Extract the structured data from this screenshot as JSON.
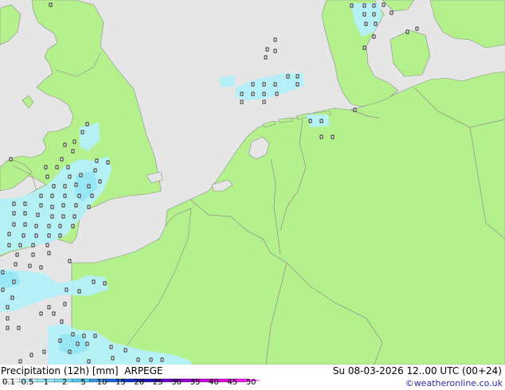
{
  "footer": {
    "title": "Precipitation (12h) [mm]",
    "model": "ARPEGE",
    "valid_time": "Su 08-03-2026 12..00 UTC (00+24)",
    "credit": "©weatheronline.co.uk"
  },
  "legend": {
    "ticks": [
      "0.1",
      "0.5",
      "1",
      "2",
      "5",
      "10",
      "15",
      "20",
      "25",
      "30",
      "35",
      "40",
      "45",
      "50"
    ],
    "colors": [
      "#ffffff",
      "#b4f0fa",
      "#96e6f5",
      "#78dcf0",
      "#4cc8f0",
      "#3296e6",
      "#1e64dc",
      "#1432c8",
      "#2814b4",
      "#6400c8",
      "#9600d2",
      "#c800dc",
      "#e600e6",
      "#f01ef0"
    ]
  },
  "map": {
    "sea_color": "#e6e6e6",
    "land_color": "#b4f08c",
    "precip_color": "#b4f0fa",
    "precip_color_strong": "#96e6f5"
  }
}
